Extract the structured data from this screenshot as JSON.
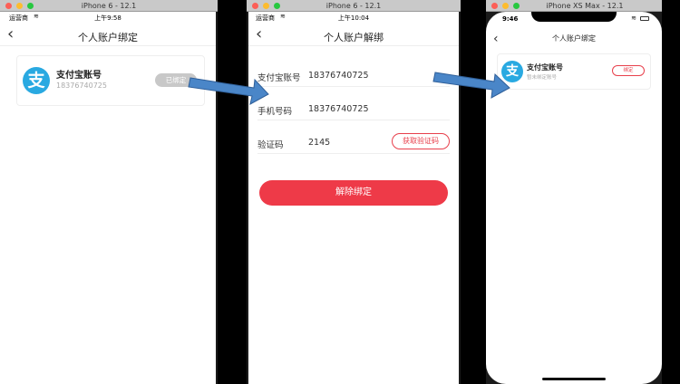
{
  "windows": [
    {
      "title": "iPhone 6 - 12.1"
    },
    {
      "title": "iPhone 6 - 12.1"
    },
    {
      "title": "iPhone XS Max - 12.1"
    }
  ],
  "screen1": {
    "carrier": "运营商",
    "time": "上午9:58",
    "nav_title": "个人账户绑定",
    "card_title": "支付宝账号",
    "card_sub": "18376740725",
    "card_button": "已绑定",
    "alipay_glyph": "支"
  },
  "screen2": {
    "carrier": "运营商",
    "time": "上午10:04",
    "nav_title": "个人账户解绑",
    "rows": [
      {
        "label": "支付宝账号",
        "value": "18376740725"
      },
      {
        "label": "手机号码",
        "value": "18376740725"
      },
      {
        "label": "验证码",
        "value": "2145"
      }
    ],
    "code_button": "获取验证码",
    "unbind_button": "解除绑定"
  },
  "screen3": {
    "time": "9:46",
    "nav_title": "个人账户绑定",
    "card_title": "支付宝账号",
    "card_sub": "暂未绑定账号",
    "card_button": "绑定",
    "alipay_glyph": "支"
  },
  "colors": {
    "accent_red": "#ee3a48",
    "alipay_blue": "#29a9e1",
    "arrow_blue": "#4a86c8"
  }
}
